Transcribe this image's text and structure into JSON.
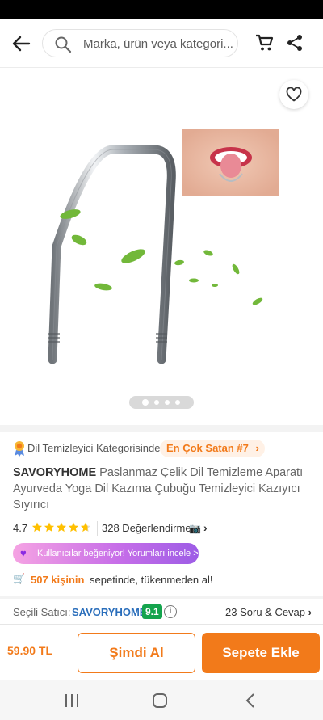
{
  "header": {
    "search_placeholder": "Marka, ürün veya kategori..."
  },
  "gallery": {
    "image_count": 4,
    "active_index": 0
  },
  "product": {
    "category_text": "Dil Temizleyici Kategorisinde",
    "best_seller_badge": "En Çok Satan #7",
    "brand": "SAVORYHOME",
    "title": " Paslanmaz Çelik Dil Temizleme Aparatı Ayurveda Yoga Dil Kazıma Çubuğu Temizleyici Kazıyıcı Sıyırıcı",
    "rating": "4.7",
    "rating_value": 4.7,
    "review_count": "328 Değerlendirme",
    "liked_banner": "Kullanıcılar beğeniyor! Yorumları incele >",
    "cart_count": "507 kişinin",
    "cart_notice_rest": "sepetinde, tükenmeden al!"
  },
  "seller": {
    "label": "Seçili Satıcı:",
    "name": "SAVORYHOME",
    "score": "9.1",
    "qa_link": "23 Soru & Cevap"
  },
  "purchase": {
    "price": "59.90 TL",
    "buy_now_label": "Şimdi Al",
    "add_to_cart_label": "Sepete Ekle"
  },
  "colors": {
    "accent": "#f27a1a",
    "seller_link": "#2a6ebb",
    "score_green": "#14a44d"
  }
}
